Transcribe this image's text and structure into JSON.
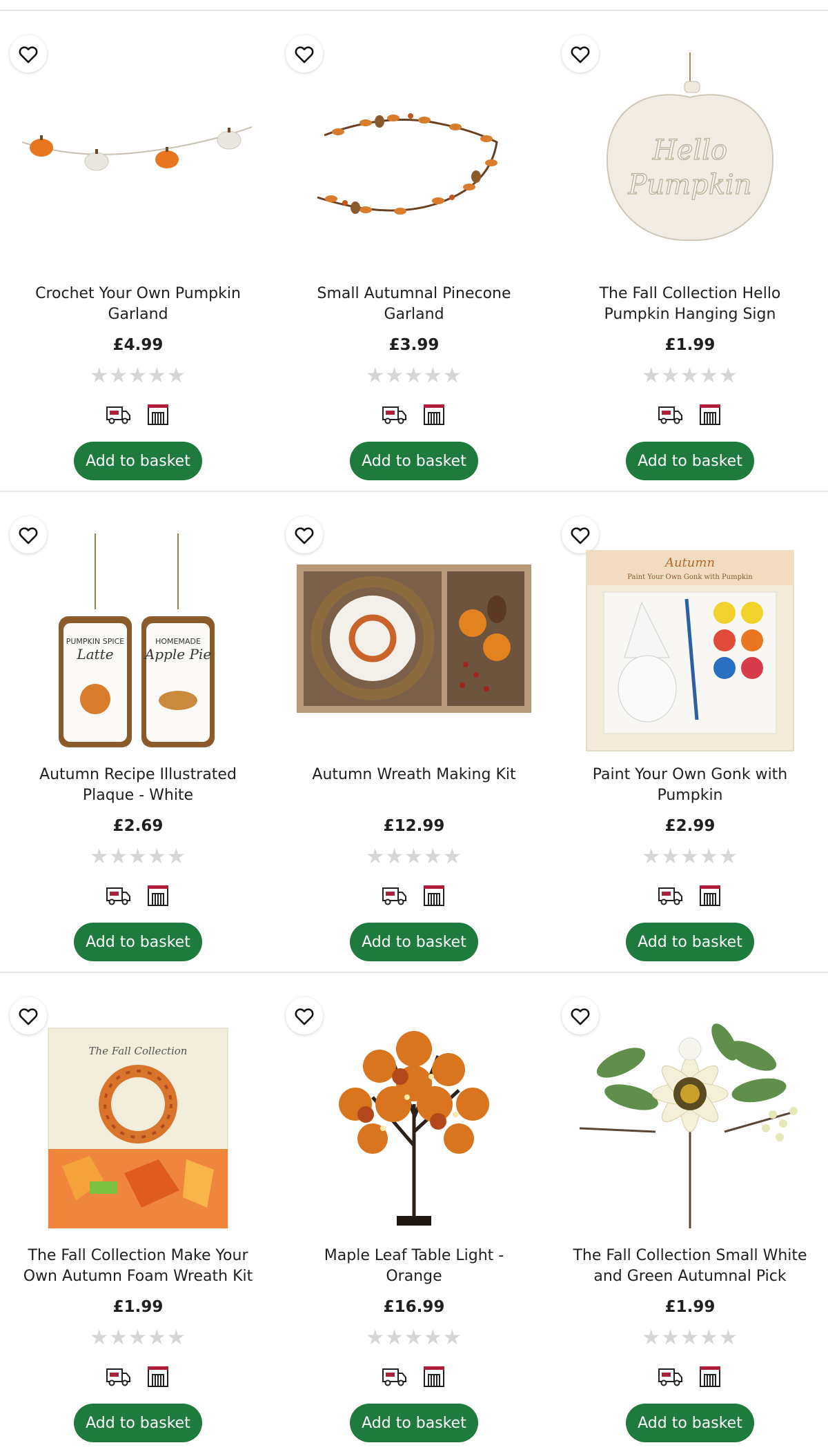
{
  "colors": {
    "button": "#1f7a3d",
    "star_empty": "#d6d6d6",
    "icon_accent": "#b01e3a"
  },
  "products": [
    {
      "name": "Crochet Your Own Pumpkin Garland",
      "price": "£4.99",
      "rating_stars": "★★★★★",
      "rating": 0,
      "button": "Add to basket",
      "image": "pumpkin-garland"
    },
    {
      "name": "Small Autumnal Pinecone Garland",
      "price": "£3.99",
      "rating_stars": "★★★★★",
      "rating": 0,
      "button": "Add to basket",
      "image": "pinecone-garland"
    },
    {
      "name": "The Fall Collection Hello Pumpkin Hanging Sign",
      "price": "£1.99",
      "rating_stars": "★★★★★",
      "rating": 0,
      "button": "Add to basket",
      "image": "hello-pumpkin-sign",
      "image_text": "Hello Pumpkin"
    },
    {
      "name": "Autumn Recipe Illustrated Plaque - White",
      "price": "£2.69",
      "rating_stars": "★★★★★",
      "rating": 0,
      "button": "Add to basket",
      "image": "recipe-plaques",
      "image_text": "PUMPKIN SPICE Latte / HOMEMADE Apple Pie"
    },
    {
      "name": "Autumn Wreath Making Kit",
      "price": "£12.99",
      "rating_stars": "★★★★★",
      "rating": 0,
      "button": "Add to basket",
      "image": "wreath-kit"
    },
    {
      "name": "Paint Your Own Gonk with Pumpkin",
      "price": "£2.99",
      "rating_stars": "★★★★★",
      "rating": 0,
      "button": "Add to basket",
      "image": "gonk-kit",
      "image_text": "Autumn Paint Your Own Gonk with Pumpkin"
    },
    {
      "name": "The Fall Collection Make Your Own Autumn Foam Wreath Kit",
      "price": "£1.99",
      "rating_stars": "★★★★★",
      "rating": 0,
      "button": "Add to basket",
      "image": "foam-wreath-kit",
      "image_text": "The Fall Collection"
    },
    {
      "name": "Maple Leaf Table Light - Orange",
      "price": "£16.99",
      "rating_stars": "★★★★★",
      "rating": 0,
      "button": "Add to basket",
      "image": "maple-light"
    },
    {
      "name": "The Fall Collection Small White and Green Autumnal Pick",
      "price": "£1.99",
      "rating_stars": "★★★★★",
      "rating": 0,
      "button": "Add to basket",
      "image": "sunflower-pick"
    }
  ],
  "icons": {
    "wishlist": "heart-outline-icon",
    "delivery": "delivery-van-icon",
    "store": "store-icon"
  }
}
